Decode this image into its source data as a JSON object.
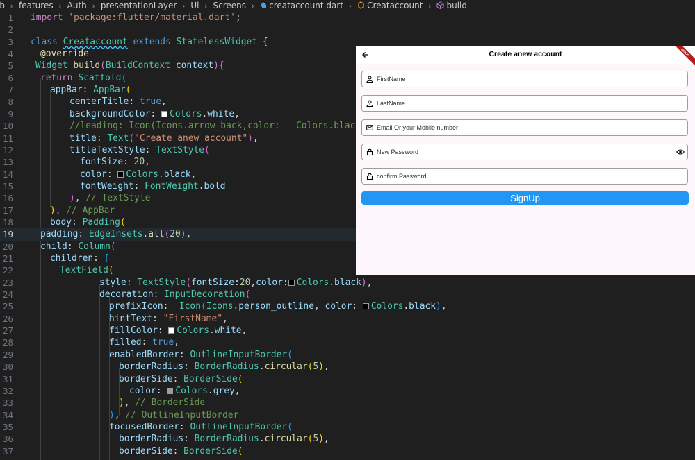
{
  "breadcrumb": {
    "segments": [
      "lib",
      "features",
      "Auth",
      "presentationLayer",
      "Ui",
      "Screens",
      "creataccount.dart",
      "Creataccount",
      "build"
    ]
  },
  "editor": {
    "active_line": 19,
    "line_numbers": [
      "1",
      "2",
      "3",
      "4",
      "5",
      "6",
      "7",
      "8",
      "9",
      "10",
      "11",
      "12",
      "13",
      "14",
      "15",
      "16",
      "17",
      "18",
      "19",
      "20",
      "21",
      "22",
      "23",
      "24",
      "25",
      "26",
      "27",
      "28",
      "29",
      "30",
      "31",
      "32",
      "33",
      "34",
      "35",
      "36",
      "37"
    ]
  },
  "preview": {
    "app_title": "Create anew account",
    "debug_banner": "DEBUG",
    "fields": [
      {
        "hint": "FirstName",
        "icon": "person-outline-icon"
      },
      {
        "hint": "LastName",
        "icon": "person-outline-icon"
      },
      {
        "hint": "Email Or your Mobile number",
        "icon": "mail-outline-icon"
      },
      {
        "hint": "New Password",
        "icon": "lock-outline-icon",
        "trailing_icon": "visibility-icon"
      },
      {
        "hint": "confirm Password",
        "icon": "lock-outline-icon"
      }
    ],
    "signup_label": "SignUp",
    "colors": {
      "button": "#2196f3",
      "background": "#fdf7fb",
      "border": "#9e9e9e"
    }
  }
}
